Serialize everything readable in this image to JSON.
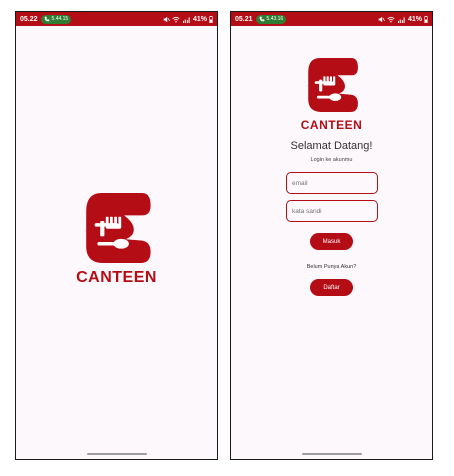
{
  "status_left": {
    "time": "05.22",
    "call_time": "5.44.15",
    "battery": "41%"
  },
  "status_right": {
    "time": "05.21",
    "call_time": "5.43.16",
    "battery": "41%"
  },
  "brand": {
    "name": "CANTEEN",
    "color": "#b50d15"
  },
  "login": {
    "welcome": "Selamat Datang!",
    "subtitle": "Login ke akunmu",
    "email_placeholder": "email",
    "password_placeholder": "kata sandi",
    "login_label": "Masuk",
    "no_account_text": "Belum Punya Akun?",
    "register_label": "Daftar"
  },
  "icons": [
    "phone-icon",
    "mute-icon",
    "wifi-icon",
    "signal-icon",
    "battery-icon",
    "canteen-logo-icon"
  ]
}
